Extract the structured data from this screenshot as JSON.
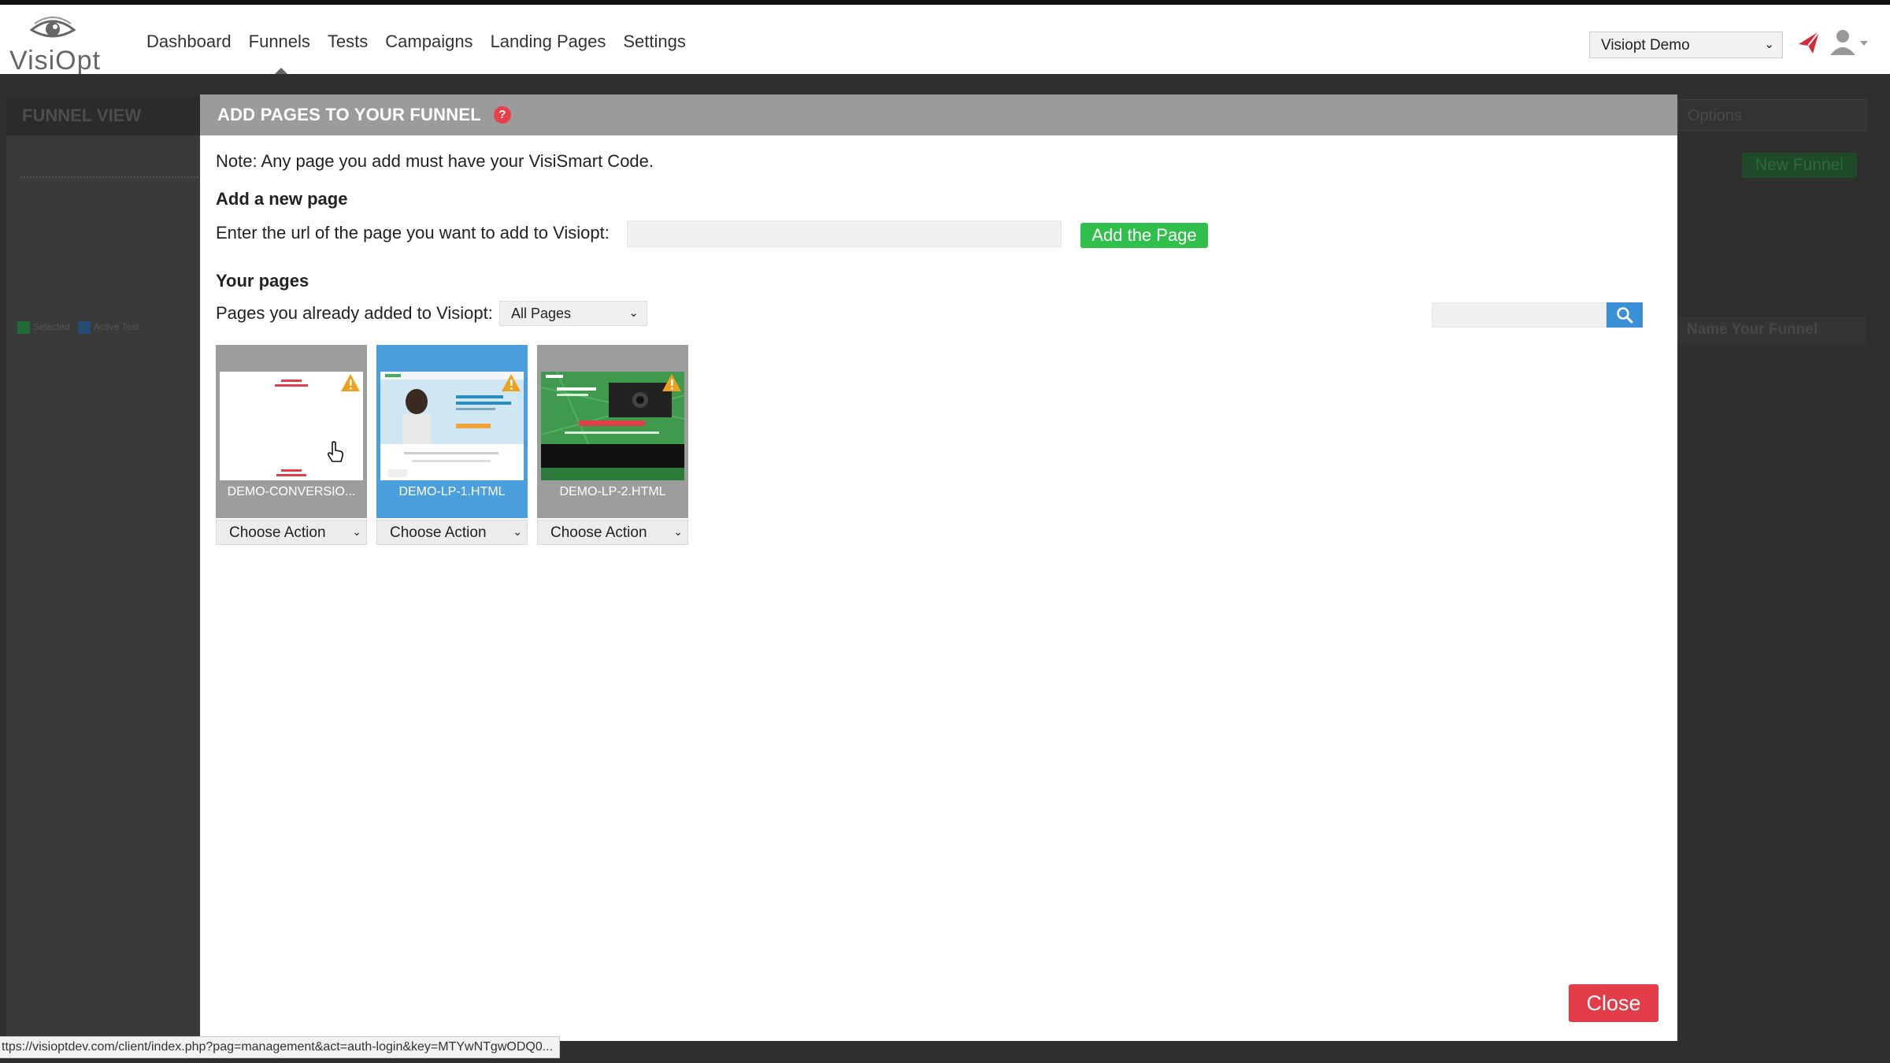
{
  "app": {
    "logo_text": "VisiOpt",
    "nav": [
      "Dashboard",
      "Funnels",
      "Tests",
      "Campaigns",
      "Landing Pages",
      "Settings"
    ],
    "account": "Visiopt Demo"
  },
  "background": {
    "funnel_view": "FUNNEL VIEW",
    "name_placeholder": "Name Your Funnel",
    "legend": [
      "Selected",
      "Active Test"
    ],
    "right_select": "Options",
    "new_funnel": "New Funnel",
    "right_select2": "Name Your Funnel"
  },
  "modal": {
    "title": "ADD PAGES TO YOUR FUNNEL",
    "help": "?",
    "note": "Note: Any page you add must have your VisiSmart Code.",
    "add_heading": "Add a new page",
    "url_label": "Enter the url of the page you want to add to Visiopt:",
    "url_value": "",
    "add_button": "Add the Page",
    "pages_heading": "Your pages",
    "pages_label": "Pages you already added to Visiopt:",
    "pages_filter": "All Pages",
    "search_value": "",
    "pages": [
      {
        "name": "DEMO-CONVERSIO...",
        "action": "Choose Action",
        "selected": false
      },
      {
        "name": "DEMO-LP-1.HTML",
        "action": "Choose Action",
        "selected": true
      },
      {
        "name": "DEMO-LP-2.HTML",
        "action": "Choose Action",
        "selected": false
      }
    ],
    "close_button": "Close"
  },
  "status_bar": {
    "url": "ttps://visioptdev.com/client/index.php?pag=management&act=auth-login&key=MTYwNTgwODQ0..."
  },
  "colors": {
    "accent_green": "#2fbf4a",
    "close_red": "#e23d48",
    "selected_blue": "#4a9fdc",
    "header_grey": "#9b9b9b"
  }
}
